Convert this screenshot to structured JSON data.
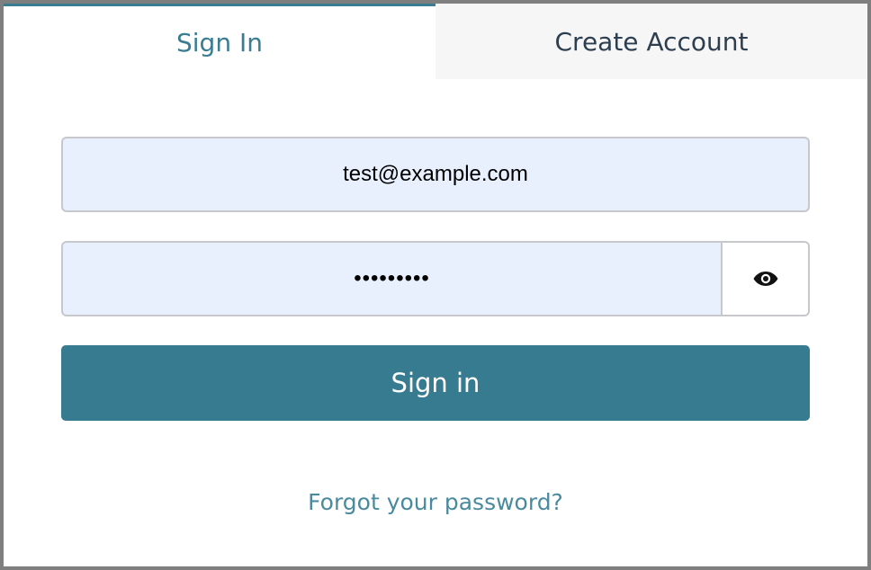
{
  "tabs": {
    "sign_in": "Sign In",
    "create_account": "Create Account"
  },
  "form": {
    "email_value": "test@example.com",
    "password_masked": "•••••••••",
    "reveal_icon": "eye-icon",
    "submit_label": "Sign in",
    "forgot_link": "Forgot your password?"
  },
  "colors": {
    "accent": "#377b91",
    "active_tab_text": "#3a7d92",
    "inactive_tab_text": "#2c3e50",
    "autofill_bg": "#e8f0fe"
  }
}
